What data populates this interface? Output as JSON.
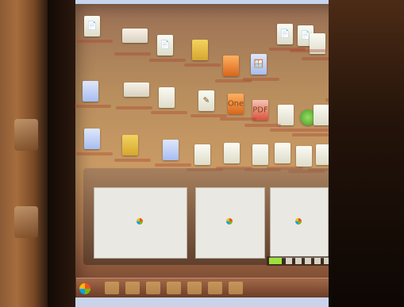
{
  "scene": {
    "subject": "",
    "screen": {
      "icons": [
        {
          "type": "doc",
          "glyph": "📄"
        },
        {
          "type": "wide",
          "glyph": ""
        },
        {
          "type": "doc",
          "glyph": "📄"
        },
        {
          "type": "folder",
          "glyph": ""
        },
        {
          "type": "orange",
          "glyph": ""
        },
        {
          "type": "blue",
          "glyph": "🪟"
        },
        {
          "type": "doc",
          "glyph": "📄"
        },
        {
          "type": "doc",
          "glyph": "📄"
        },
        {
          "type": "blue",
          "glyph": ""
        },
        {
          "type": "wide",
          "glyph": ""
        },
        {
          "type": "doc",
          "glyph": ""
        },
        {
          "type": "doc",
          "glyph": "✎"
        },
        {
          "type": "orange",
          "glyph": "One"
        },
        {
          "type": "red",
          "glyph": "PDF"
        },
        {
          "type": "doc",
          "glyph": ""
        },
        {
          "type": "green",
          "glyph": ""
        },
        {
          "type": "doc",
          "glyph": ""
        },
        {
          "type": "doc",
          "glyph": ""
        },
        {
          "type": "blue",
          "glyph": ""
        },
        {
          "type": "folder",
          "glyph": ""
        },
        {
          "type": "blue",
          "glyph": ""
        },
        {
          "type": "doc",
          "glyph": ""
        },
        {
          "type": "doc",
          "glyph": ""
        },
        {
          "type": "doc",
          "glyph": ""
        },
        {
          "type": "doc",
          "glyph": ""
        },
        {
          "type": "doc",
          "glyph": ""
        },
        {
          "type": "doc",
          "glyph": ""
        },
        {
          "type": "blue",
          "glyph": "🏃"
        },
        {
          "type": "doc",
          "glyph": ""
        }
      ],
      "previews": [
        {
          "title": ""
        },
        {
          "title": ""
        },
        {
          "title": ""
        }
      ]
    },
    "right_panel_texts": []
  }
}
